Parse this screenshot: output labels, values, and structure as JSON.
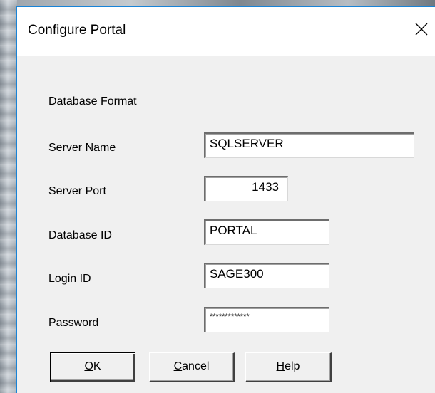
{
  "window": {
    "title": "Configure Portal",
    "close_glyph": "×",
    "close_icon": "close-icon"
  },
  "labels": {
    "database_format": "Database Format",
    "server_name": "Server Name",
    "server_port": "Server Port",
    "database_id": "Database ID",
    "login_id": "Login ID",
    "password": "Password"
  },
  "fields": {
    "server_name": "SQLSERVER",
    "server_port": "1433",
    "database_id": "PORTAL",
    "login_id": "SAGE300",
    "password": "*************"
  },
  "buttons": {
    "ok": {
      "mnemonic": "O",
      "rest": "K"
    },
    "cancel": {
      "mnemonic": "C",
      "rest": "ancel"
    },
    "help": {
      "mnemonic": "H",
      "rest": "elp"
    }
  },
  "colors": {
    "accent_border": "#1883d7",
    "dialog_bg": "#f0f0f0",
    "titlebar_bg": "#ffffff"
  }
}
